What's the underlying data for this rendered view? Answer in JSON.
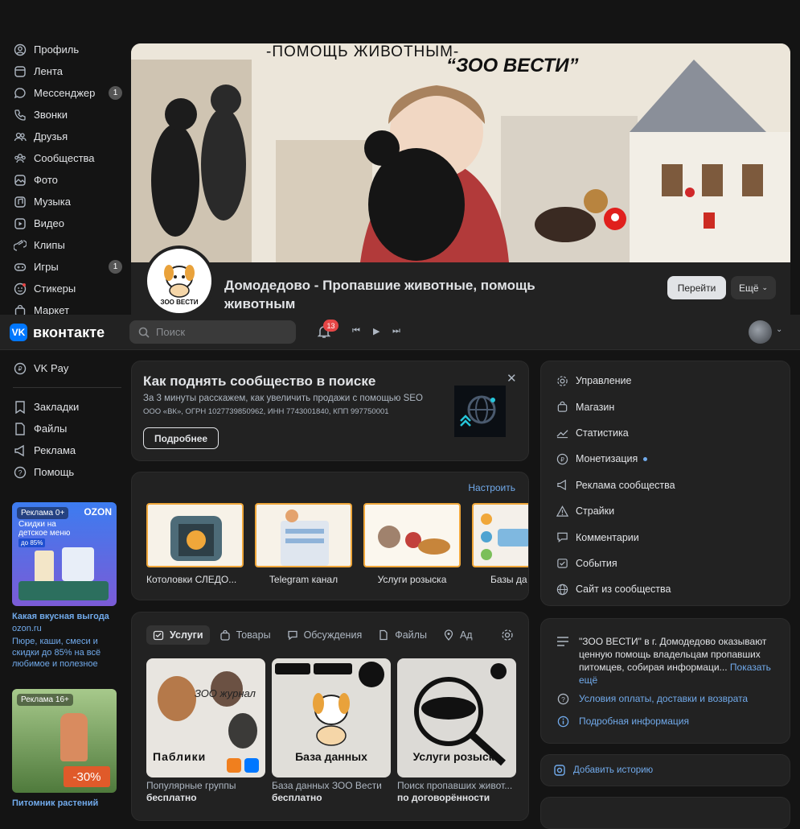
{
  "nav": {
    "items": [
      {
        "label": "Профиль",
        "icon": "user-icon",
        "badge": ""
      },
      {
        "label": "Лента",
        "icon": "feed-icon",
        "badge": ""
      },
      {
        "label": "Мессенджер",
        "icon": "chat-icon",
        "badge": "1"
      },
      {
        "label": "Звонки",
        "icon": "phone-icon",
        "badge": ""
      },
      {
        "label": "Друзья",
        "icon": "friends-icon",
        "badge": ""
      },
      {
        "label": "Сообщества",
        "icon": "groups-icon",
        "badge": ""
      },
      {
        "label": "Фото",
        "icon": "photo-icon",
        "badge": ""
      },
      {
        "label": "Музыка",
        "icon": "music-icon",
        "badge": ""
      },
      {
        "label": "Видео",
        "icon": "video-icon",
        "badge": ""
      },
      {
        "label": "Клипы",
        "icon": "clips-icon",
        "badge": ""
      },
      {
        "label": "Игры",
        "icon": "games-icon",
        "badge": "1"
      },
      {
        "label": "Стикеры",
        "icon": "sticker-icon",
        "badge": ""
      },
      {
        "label": "Маркет",
        "icon": "market-icon",
        "badge": ""
      }
    ],
    "vkpay": "VK Pay",
    "bottom": [
      "Закладки",
      "Файлы",
      "Реклама",
      "Помощь"
    ]
  },
  "ads": [
    {
      "tag": "Реклама 0+",
      "brand": "OZON",
      "promo": "Скидки на детское меню",
      "pct": "до 85%",
      "title": "Какая вкусная выгода",
      "domain": "ozon.ru",
      "text": "Пюре, каши, смеси и скидки до 85% на всё любимое и полезное"
    },
    {
      "tag": "Реклама 16+",
      "promo": "-30%",
      "title": "Питомник растений"
    }
  ],
  "topbar": {
    "logo": "вконтакте",
    "search_placeholder": "Поиск",
    "notif_count": "13"
  },
  "cover": {
    "caption_left": "-ПОМОЩЬ ЖИВОТНЫМ-",
    "caption_right": "“ЗОО ВЕСТИ”"
  },
  "group": {
    "name": "Домодедово - Пропавшие животные, помощь животным",
    "avatar_text": "ЗОО ВЕСТИ",
    "join": "Перейти",
    "more": "Ещё"
  },
  "promo_card": {
    "title": "Как поднять сообщество в поиске",
    "subtitle": "За 3 минуты расскажем, как увеличить продажи с помощью SEO",
    "legal": "ООО «ВК», ОГРН 1027739850962, ИНН 7743001840, КПП 997750001",
    "button": "Подробнее"
  },
  "showcase": {
    "configure": "Настроить",
    "items": [
      "Котоловки СЛЕДО...",
      "Telegram канал",
      "Услуги розыска",
      "Базы да"
    ]
  },
  "tabs": {
    "items": [
      "Услуги",
      "Товары",
      "Обсуждения",
      "Файлы",
      "Ад"
    ]
  },
  "services": [
    {
      "image_title": "Паблики",
      "image_sub": "ЗОО журнал",
      "name": "Популярные группы",
      "price": "бесплатно"
    },
    {
      "image_title": "База данных",
      "name": "База данных ЗОО Вести",
      "price": "бесплатно"
    },
    {
      "image_title": "Услуги розыска",
      "name": "Поиск пропавших живот...",
      "price": "по договорённости"
    }
  ],
  "admin_menu": {
    "items": [
      {
        "label": "Управление",
        "icon": "gear-icon"
      },
      {
        "label": "Магазин",
        "icon": "bag-icon"
      },
      {
        "label": "Статистика",
        "icon": "chart-icon"
      },
      {
        "label": "Монетизация",
        "icon": "coin-icon"
      },
      {
        "label": "Реклама сообщества",
        "icon": "megaphone-icon"
      },
      {
        "label": "Страйки",
        "icon": "warning-icon"
      },
      {
        "label": "Комментарии",
        "icon": "comment-icon"
      },
      {
        "label": "События",
        "icon": "calendar-check-icon"
      },
      {
        "label": "Сайт из сообщества",
        "icon": "globe-icon"
      }
    ]
  },
  "about": {
    "description": "\"ЗОО ВЕСТИ\" в г. Домодедово оказывают ценную помощь владельцам пропавших питомцев, собирая информаци...",
    "more": "Показать ещё",
    "payment": "Условия оплаты, доставки и возврата",
    "details": "Подробная информация"
  },
  "story": {
    "label": "Добавить историю"
  },
  "colors": {
    "accent": "#71aaeb",
    "vk_blue": "#0077ff",
    "bg": "#141414",
    "card": "#222222",
    "text": "#e1e3e6",
    "badge_red": "#e64646"
  }
}
